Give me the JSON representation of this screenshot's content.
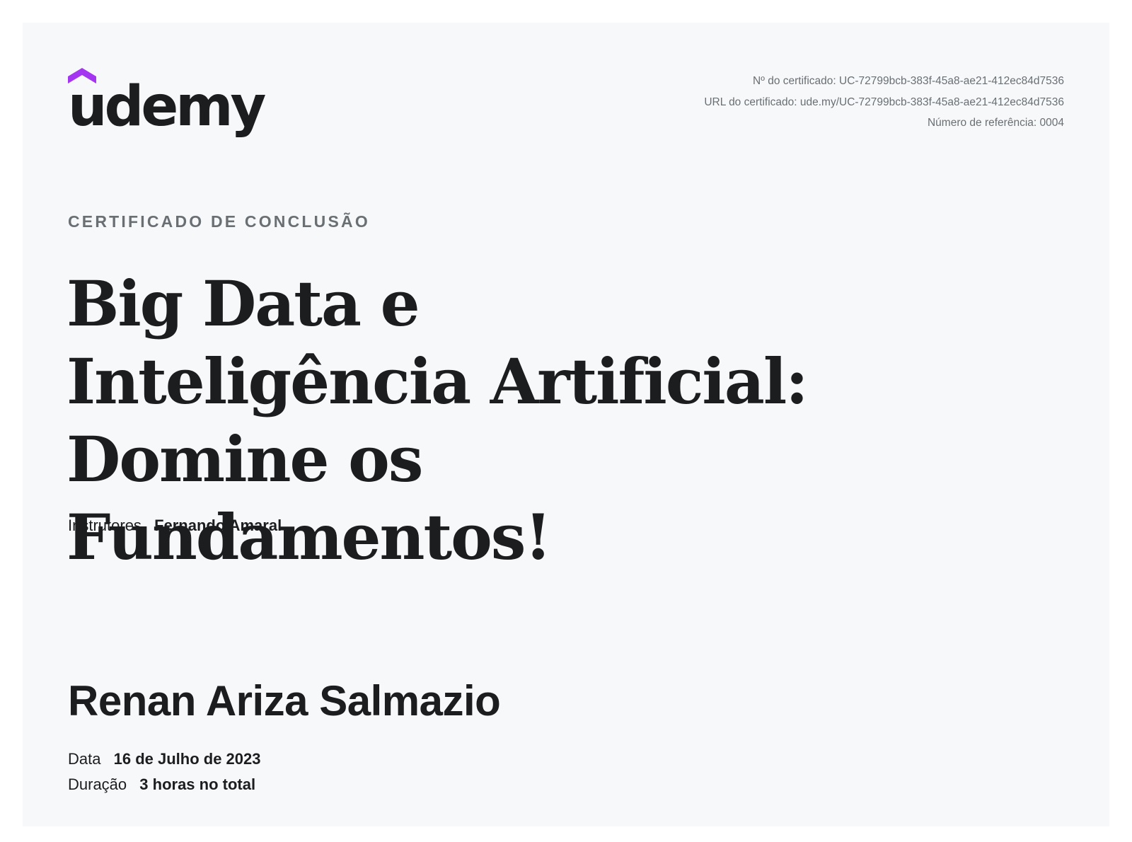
{
  "brand": {
    "name": "udemy",
    "accent_color": "#a435f0",
    "text_color": "#1c1d1f"
  },
  "meta": {
    "certificate_no": "Nº do certificado: UC-72799bcb-383f-45a8-ae21-412ec84d7536",
    "certificate_url": "URL do certificado: ude.my/UC-72799bcb-383f-45a8-ae21-412ec84d7536",
    "reference_number": "Número de referência: 0004"
  },
  "certificate": {
    "eyebrow": "CERTIFICADO DE CONCLUSÃO",
    "course_title": "Big Data e Inteligência Artificial: Domine os Fundamentos!",
    "instructors_label": "Instrutores",
    "instructors_value": "Fernando Amaral",
    "student_name": "Renan Ariza Salmazio",
    "date_label": "Data",
    "date_value": "16 de Julho de 2023",
    "duration_label": "Duração",
    "duration_value": "3 horas no total"
  }
}
